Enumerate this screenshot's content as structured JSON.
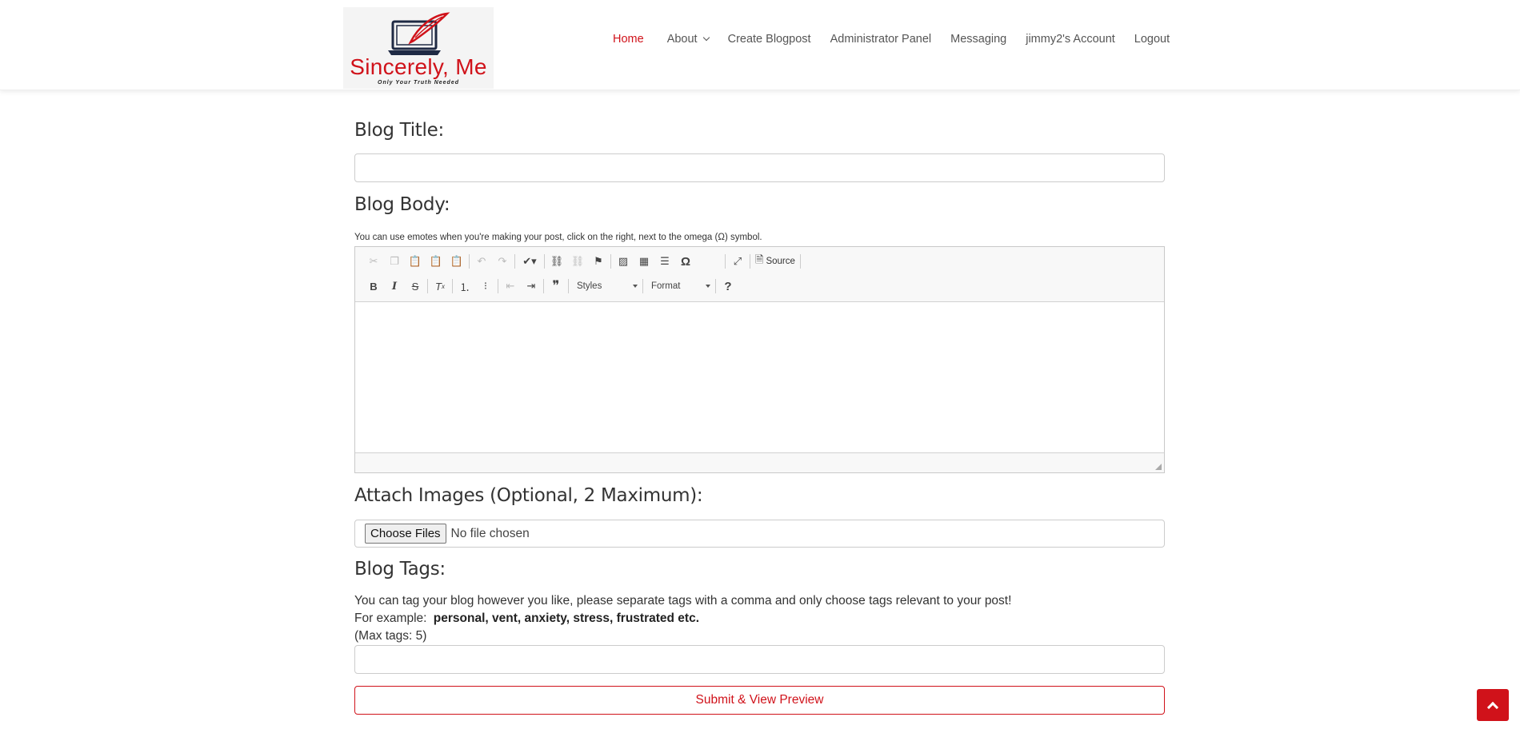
{
  "brand": {
    "name": "Sincerely, Me",
    "tagline": "Only Your Truth Needed"
  },
  "nav": {
    "items": [
      {
        "label": "Home",
        "active": true
      },
      {
        "label": "About",
        "has_dropdown": true
      },
      {
        "label": "Create Blogpost"
      },
      {
        "label": "Administrator Panel"
      },
      {
        "label": "Messaging"
      },
      {
        "label": "jimmy2's Account"
      },
      {
        "label": "Logout"
      }
    ]
  },
  "form": {
    "title_heading": "Blog Title:",
    "title_value": "",
    "body_heading": "Blog Body:",
    "body_note": "You can use emotes when you're making your post, click on the right, next to the omega (Ω) symbol.",
    "images_heading": "Attach Images (Optional, 2 Maximum):",
    "choose_files_label": "Choose Files",
    "no_file_label": "No file chosen",
    "tags_heading": "Blog Tags:",
    "tags_help_line1": "You can tag your blog however you like, please separate tags with a comma and only choose tags relevant to your post!",
    "tags_example_prefix": "For example:",
    "tags_example_values": "personal, vent, anxiety, stress, frustrated etc.",
    "tags_max": "(Max tags: 5)",
    "tags_value": "",
    "submit_label": "Submit & View Preview"
  },
  "editor": {
    "source_label": "Source",
    "styles_label": "Styles",
    "format_label": "Format",
    "omega_symbol": "Ω",
    "help_symbol": "?",
    "bold_symbol": "B",
    "italic_symbol": "I",
    "strike_symbol": "S",
    "quote_symbol": "❞",
    "row1_icons": [
      "cut-icon",
      "copy-icon",
      "paste-icon",
      "paste-text-icon",
      "paste-word-icon",
      "undo-icon",
      "redo-icon",
      "spellcheck-icon",
      "link-icon",
      "unlink-icon",
      "anchor-icon",
      "image-icon",
      "table-icon",
      "horizontal-line-icon",
      "special-char-icon",
      "maximize-icon",
      "source-icon"
    ],
    "row2_icons": [
      "bold-icon",
      "italic-icon",
      "strike-icon",
      "remove-format-icon",
      "numbered-list-icon",
      "bulleted-list-icon",
      "outdent-icon",
      "indent-icon",
      "blockquote-icon",
      "help-icon"
    ]
  },
  "colors": {
    "accent": "#d0121a",
    "text": "#333333",
    "toolbar_bg": "#f8f8f8"
  }
}
